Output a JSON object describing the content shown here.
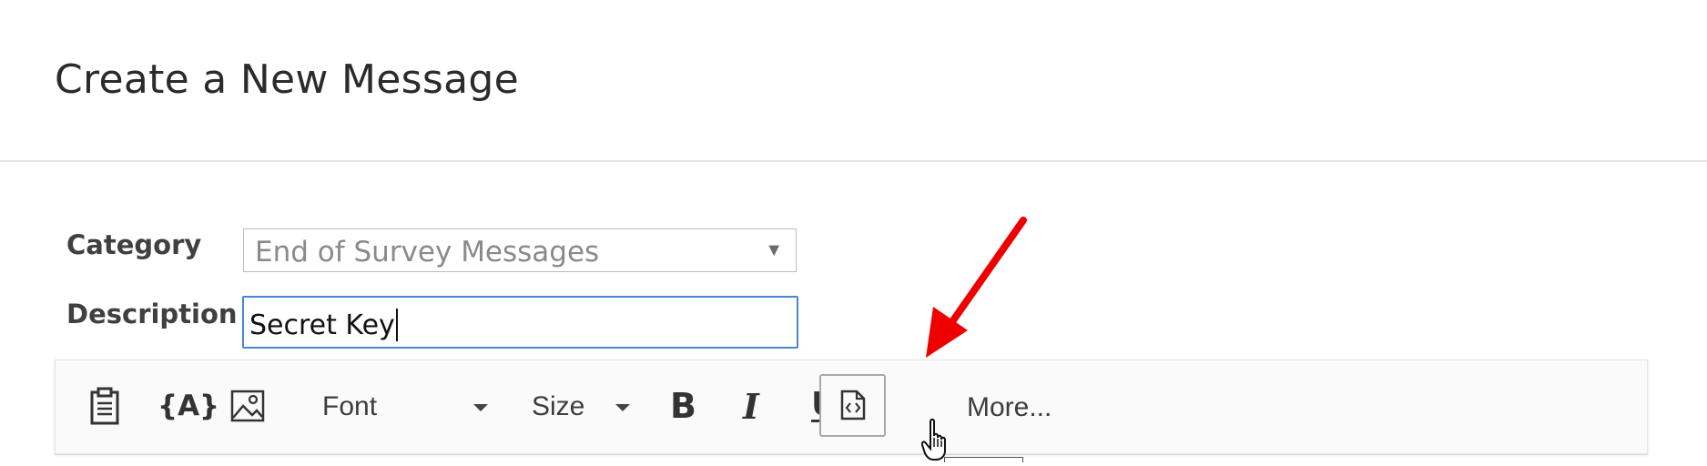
{
  "dialog": {
    "title": "Create a New Message"
  },
  "form": {
    "category_label": "Category",
    "category_value": "End of Survey Messages",
    "description_label": "Description",
    "description_value": "Secret Key"
  },
  "toolbar": {
    "font_label": "Font",
    "size_label": "Size",
    "more_label": "More..."
  },
  "icons": {
    "paste": "clipboard-icon",
    "piped_text": "piped-text-icon",
    "image": "image-icon",
    "bold": "bold-icon",
    "italic": "italic-icon",
    "underline": "underline-icon",
    "source": "source-code-icon"
  },
  "colors": {
    "annotation_arrow": "#ee0000",
    "input_focus_border": "#4a86d6"
  }
}
